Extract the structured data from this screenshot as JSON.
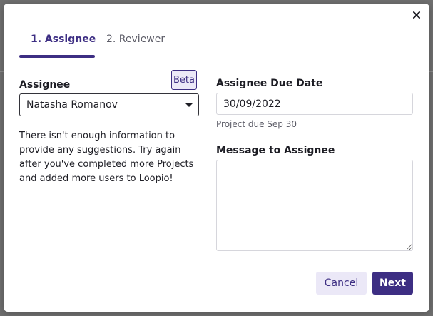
{
  "dialog": {
    "tabs": [
      {
        "label": "1. Assignee",
        "active": true
      },
      {
        "label": "2. Reviewer",
        "active": false
      }
    ],
    "assignee": {
      "label": "Assignee",
      "badge": "Beta",
      "selected": "Natasha Romanov",
      "info": "There isn't enough information to provide any suggestions. Try again after you've completed more Projects and added more users to Loopio!"
    },
    "due_date": {
      "label": "Assignee Due Date",
      "value": "30/09/2022",
      "hint": "Project due Sep 30"
    },
    "message": {
      "label": "Message to Assignee",
      "value": ""
    },
    "buttons": {
      "cancel": "Cancel",
      "next": "Next"
    }
  },
  "colors": {
    "accent": "#3d2e83",
    "accent_light": "#ebe8f7",
    "border": "#d6d6dc"
  }
}
